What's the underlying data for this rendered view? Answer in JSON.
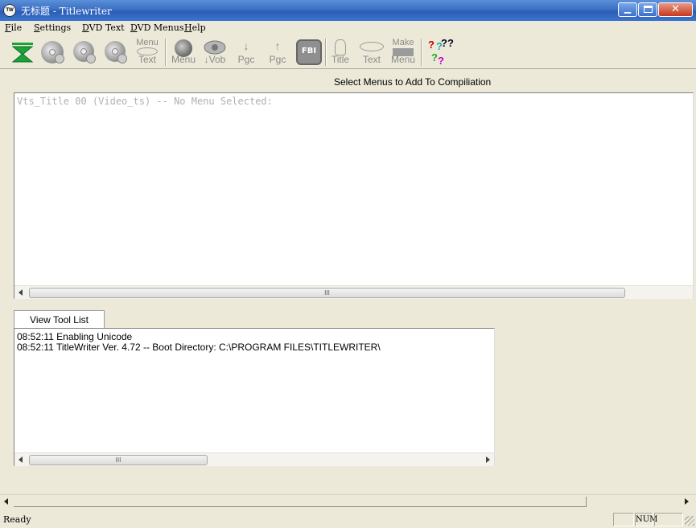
{
  "window": {
    "title": "无标题 - Titlewriter",
    "icon_text": "TW"
  },
  "menu": [
    {
      "label": "File"
    },
    {
      "label": "Settings"
    },
    {
      "label": "DVD Text"
    },
    {
      "label": "DVD Menus"
    },
    {
      "label": "Help"
    }
  ],
  "toolbar": {
    "menu_text_top": "Menu",
    "menu_text_bottom": "Text",
    "menu": "Menu",
    "vob": "Vob",
    "pgc1": "Pgc",
    "pgc2": "Pgc",
    "fbi": "FBI",
    "title": "Title",
    "text": "Text",
    "make_menu_top": "Make",
    "make_menu_bottom": "Menu",
    "help_glyph": "??"
  },
  "main": {
    "header": "Select Menus to Add To Compiliation",
    "panel_text": "Vts_Title 00 (Video_ts) -- No Menu Selected:",
    "scroll_grip": "III"
  },
  "tab": {
    "label": "View Tool List"
  },
  "log": {
    "lines": [
      "08:52:11 Enabling Unicode",
      "08:52:11 TitleWriter Ver. 4.72  -- Boot Directory: C:\\PROGRAM FILES\\TITLEWRITER\\"
    ],
    "scroll_grip": "III"
  },
  "status": {
    "text": "Ready",
    "num": "NUM"
  },
  "colors": {
    "titlebar": "#2a5db5",
    "accent_green": "#1aa33a",
    "disabled_gray": "#8a8a8a"
  }
}
